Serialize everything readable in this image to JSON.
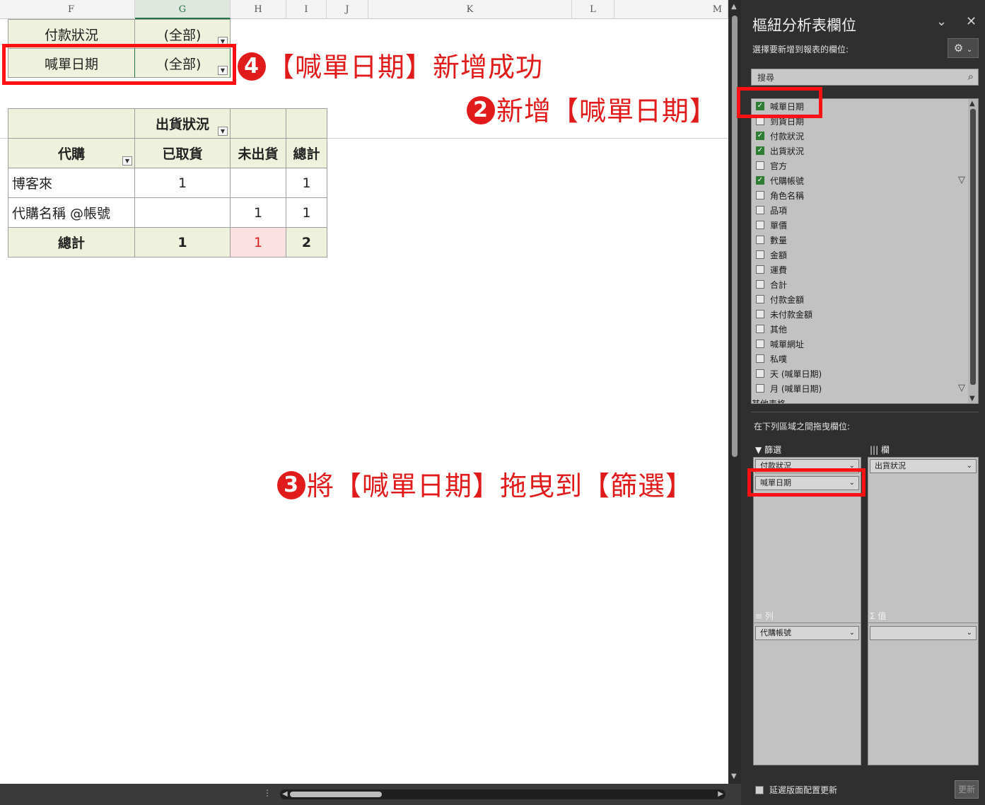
{
  "sheet": {
    "columns": [
      "F",
      "G",
      "H",
      "I",
      "J",
      "K",
      "L",
      "M"
    ],
    "filters": [
      {
        "name": "付款狀況",
        "value": "(全部)"
      },
      {
        "name": "喊單日期",
        "value": "(全部)"
      }
    ],
    "pivot": {
      "col_field": "出貨狀況",
      "row_field": "代購",
      "col_headers": [
        "已取貨",
        "未出貨",
        "總計"
      ],
      "rows": [
        {
          "label": "博客來",
          "v1": "1",
          "v2": "",
          "v3": "1"
        },
        {
          "label": "代購名稱 @帳號",
          "v1": "",
          "v2": "1",
          "v3": "1"
        }
      ],
      "total": {
        "label": "總計",
        "v1": "1",
        "v2": "1",
        "v3": "2"
      }
    }
  },
  "annotations": {
    "a4": {
      "num": "4",
      "text": "【喊單日期】新增成功"
    },
    "a2": {
      "num": "2",
      "text": "新增【喊單日期】"
    },
    "a3": {
      "num": "3",
      "text": "將【喊單日期】拖曳到【篩選】"
    }
  },
  "pane": {
    "title": "樞紐分析表欄位",
    "subtitle": "選擇要新增到報表的欄位:",
    "search_placeholder": "搜尋",
    "fields": [
      {
        "label": "喊單日期",
        "checked": true
      },
      {
        "label": "到貨日期",
        "checked": false
      },
      {
        "label": "付款狀況",
        "checked": true
      },
      {
        "label": "出貨狀況",
        "checked": true
      },
      {
        "label": "官方",
        "checked": false
      },
      {
        "label": "代購帳號",
        "checked": true,
        "filtered": true
      },
      {
        "label": "角色名稱",
        "checked": false
      },
      {
        "label": "品項",
        "checked": false
      },
      {
        "label": "單價",
        "checked": false
      },
      {
        "label": "數量",
        "checked": false
      },
      {
        "label": "金額",
        "checked": false
      },
      {
        "label": "運費",
        "checked": false
      },
      {
        "label": "合計",
        "checked": false
      },
      {
        "label": "付款金額",
        "checked": false
      },
      {
        "label": "未付款金額",
        "checked": false
      },
      {
        "label": "其他",
        "checked": false
      },
      {
        "label": "喊單網址",
        "checked": false
      },
      {
        "label": "私噗",
        "checked": false
      },
      {
        "label": "天 (喊單日期)",
        "checked": false
      },
      {
        "label": "月 (喊單日期)",
        "checked": false,
        "filtered": true
      },
      {
        "label": "其他表格...",
        "checked": false
      }
    ],
    "drag_label": "在下列區域之間拖曳欄位:",
    "areas": {
      "filters": {
        "title": "篩選",
        "items": [
          "付款狀況",
          "喊單日期"
        ]
      },
      "columns": {
        "title": "欄",
        "items": [
          "出貨狀況"
        ]
      },
      "rows": {
        "title": "列",
        "items": [
          "代購帳號"
        ]
      },
      "values": {
        "title": "值",
        "items": [
          ""
        ]
      }
    },
    "defer_label": "延遲版面配置更新",
    "update_label": "更新"
  },
  "colors": {
    "accent_red": "#e11b1b",
    "pivot_header_bg": "#eef2dc",
    "excel_green": "#217346"
  }
}
